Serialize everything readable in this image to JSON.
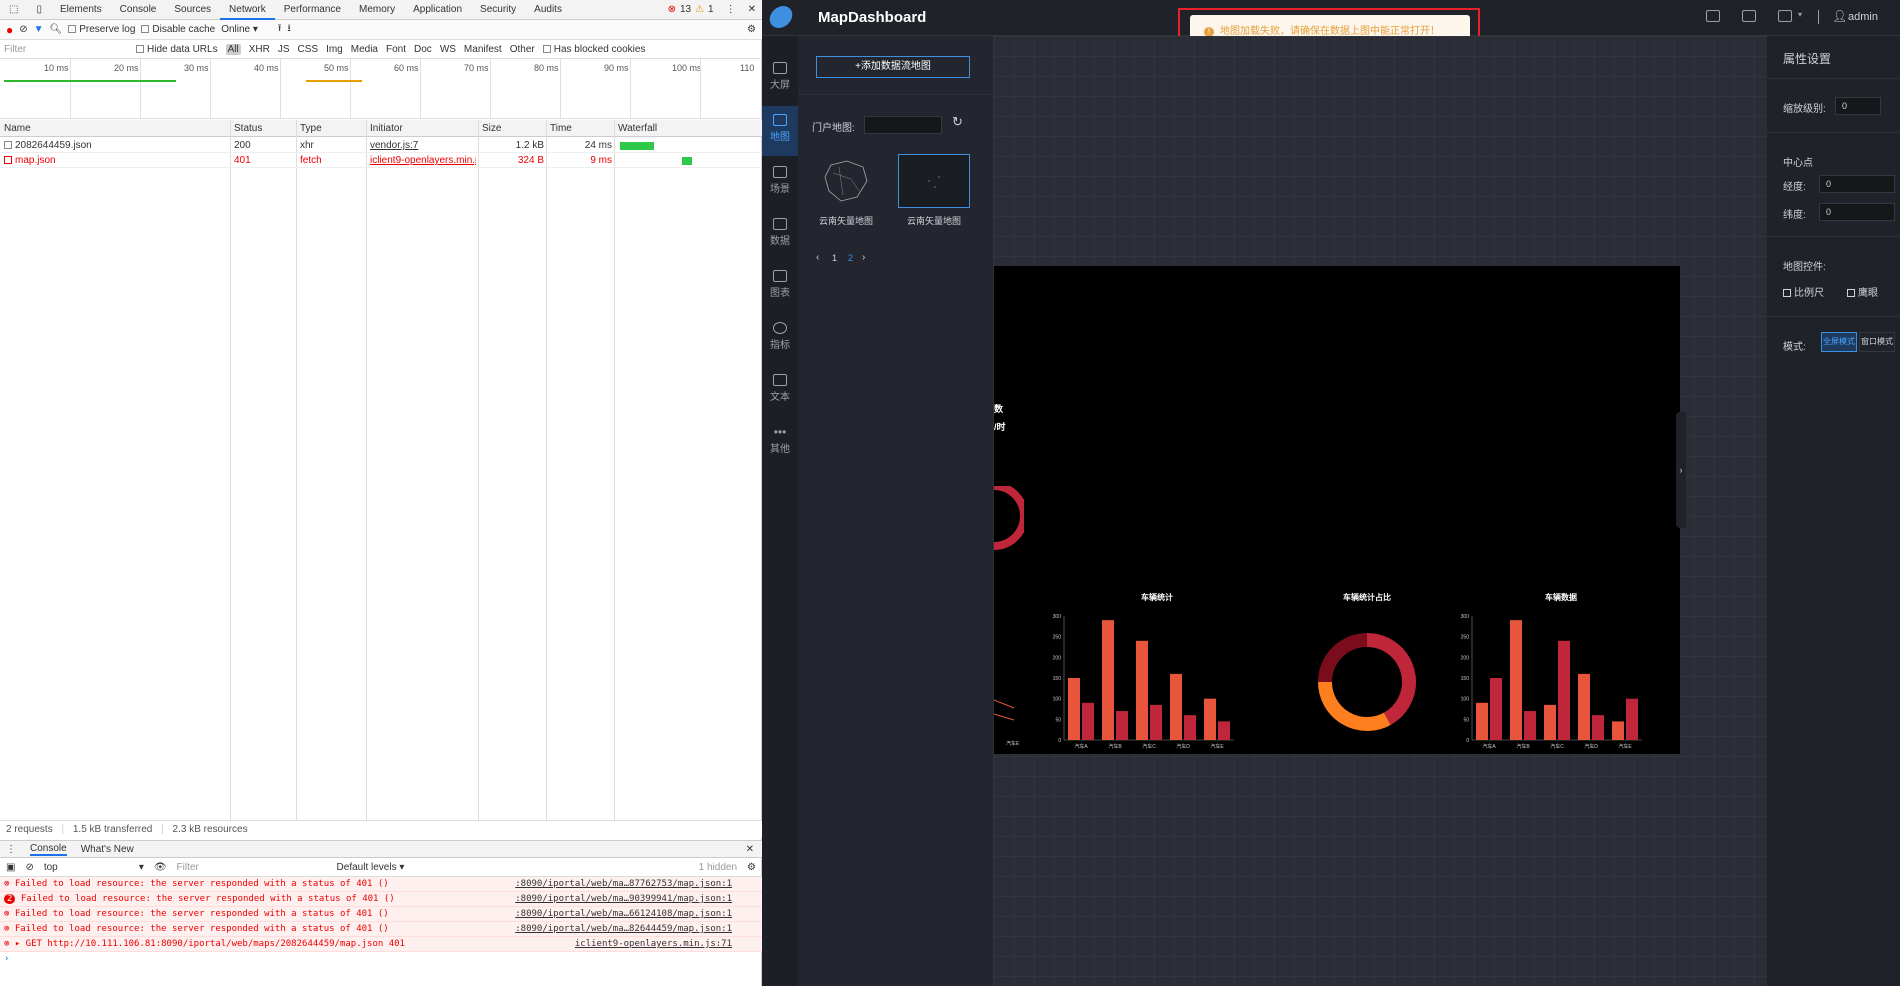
{
  "devtools": {
    "tabs": [
      "Elements",
      "Console",
      "Sources",
      "Network",
      "Performance",
      "Memory",
      "Application",
      "Security",
      "Audits"
    ],
    "active_tab": "Network",
    "error_count": "13",
    "warning_count": "1",
    "toolbar": {
      "preserve_log": "Preserve log",
      "disable_cache": "Disable cache",
      "throttle": "Online"
    },
    "filter": {
      "placeholder": "Filter",
      "hide_data_urls": "Hide data URLs",
      "types": [
        "All",
        "XHR",
        "JS",
        "CSS",
        "Img",
        "Media",
        "Font",
        "Doc",
        "WS",
        "Manifest",
        "Other"
      ],
      "has_blocked_cookies": "Has blocked cookies"
    },
    "timeline_ticks": [
      "10 ms",
      "20 ms",
      "30 ms",
      "40 ms",
      "50 ms",
      "60 ms",
      "70 ms",
      "80 ms",
      "90 ms",
      "100 ms",
      "110"
    ],
    "columns": [
      "Name",
      "Status",
      "Type",
      "Initiator",
      "Size",
      "Time",
      "Waterfall"
    ],
    "requests": [
      {
        "name": "2082644459.json",
        "status": "200",
        "type": "xhr",
        "initiator": "vendor.js:7",
        "size": "1.2 kB",
        "time": "24 ms",
        "error": false
      },
      {
        "name": "map.json",
        "status": "401",
        "type": "fetch",
        "initiator": "iclient9-openlayers.min.js...",
        "size": "324 B",
        "time": "9 ms",
        "error": true
      }
    ],
    "status_bar": {
      "requests": "2 requests",
      "transferred": "1.5 kB transferred",
      "resources": "2.3 kB resources"
    },
    "drawer_tabs": [
      "Console",
      "What's New"
    ],
    "console_toolbar": {
      "context": "top",
      "filter_placeholder": "Filter",
      "levels": "Default levels",
      "hidden": "1 hidden"
    },
    "console_messages": [
      {
        "text": "Failed to load resource: the server responded with a status of 401 ()",
        "source": ":8090/iportal/web/ma…87762753/map.json:1"
      },
      {
        "text": "Failed to load resource: the server responded with a status of 401 ()",
        "source": ":8090/iportal/web/ma…90399941/map.json:1"
      },
      {
        "text": "Failed to load resource: the server responded with a status of 401 ()",
        "source": ":8090/iportal/web/ma…66124108/map.json:1"
      },
      {
        "text": "Failed to load resource: the server responded with a status of 401 ()",
        "source": ":8090/iportal/web/ma…82644459/map.json:1"
      }
    ],
    "console_get": {
      "text": "▸ GET http://10.111.106.81:8090/iportal/web/maps/2082644459/map.json 401",
      "source": "iclient9-openlayers.min.js:71"
    },
    "repeat_badge": "2"
  },
  "app": {
    "title": "MapDashboard",
    "user": "admin",
    "toast": "地图加载失败，请确保在数据上图中能正常打开！",
    "sidebar": [
      {
        "label": "大屏",
        "icon": "screen-icon"
      },
      {
        "label": "地图",
        "icon": "map-icon"
      },
      {
        "label": "场景",
        "icon": "cube-icon"
      },
      {
        "label": "数据",
        "icon": "database-icon"
      },
      {
        "label": "图表",
        "icon": "bar-chart-icon"
      },
      {
        "label": "指标",
        "icon": "gauge-icon"
      },
      {
        "label": "文本",
        "icon": "text-icon"
      },
      {
        "label": "其他",
        "icon": "more-icon"
      }
    ],
    "active_sidebar": "地图",
    "panel": {
      "add_button": "+添加数据流地图",
      "portal_label": "门户地图:",
      "maps": [
        {
          "label": "云南矢量地图"
        },
        {
          "label": "云南矢量地图"
        }
      ],
      "pages": [
        "1",
        "2"
      ],
      "current_page": "2"
    },
    "props": {
      "title": "属性设置",
      "zoom_label": "缩放级别:",
      "zoom_value": "0",
      "center_label": "中心点",
      "lon_label": "经度:",
      "lon_value": "0",
      "lat_label": "纬度:",
      "lat_value": "0",
      "controls_label": "地图控件:",
      "scale_label": "比例尺",
      "overview_label": "鹰眼",
      "mode_label": "模式:",
      "mode_options": [
        "全屏模式",
        "窗口模式"
      ],
      "active_mode": "全屏模式"
    },
    "bigscreen": {
      "partial_text_1": "数",
      "partial_text_2": "/时",
      "partial_axis": "汽车E"
    },
    "colors": {
      "accent": "#3d8fe0",
      "bar_orange": "#e8553a",
      "bar_red": "#c0263a",
      "donut_orange": "#ff7f1f",
      "donut_dark": "#7a0c1c"
    }
  },
  "chart_data": [
    {
      "type": "bar",
      "title": "车辆统计",
      "categories": [
        "汽车A",
        "汽车B",
        "汽车C",
        "汽车D",
        "汽车E"
      ],
      "series": [
        {
          "values": [
            150,
            290,
            240,
            160,
            100
          ]
        },
        {
          "values": [
            90,
            70,
            85,
            60,
            45
          ]
        }
      ],
      "ylim": [
        0,
        300
      ],
      "yticks": [
        "300",
        "250",
        "200",
        "150",
        "100",
        "50",
        "0"
      ]
    },
    {
      "type": "pie",
      "title": "车辆统计占比",
      "values": [
        42,
        33,
        25
      ],
      "colors": [
        "#c0263a",
        "#ff7f1f",
        "#7a0c1c"
      ]
    },
    {
      "type": "bar",
      "title": "车辆数据",
      "categories": [
        "汽车A",
        "汽车B",
        "汽车C",
        "汽车D",
        "汽车E"
      ],
      "series": [
        {
          "values": [
            90,
            290,
            85,
            160,
            45
          ]
        },
        {
          "values": [
            150,
            70,
            240,
            60,
            100
          ]
        }
      ],
      "ylim": [
        0,
        300
      ],
      "yticks": [
        "300",
        "250",
        "200",
        "150",
        "100",
        "50",
        "0"
      ]
    }
  ]
}
